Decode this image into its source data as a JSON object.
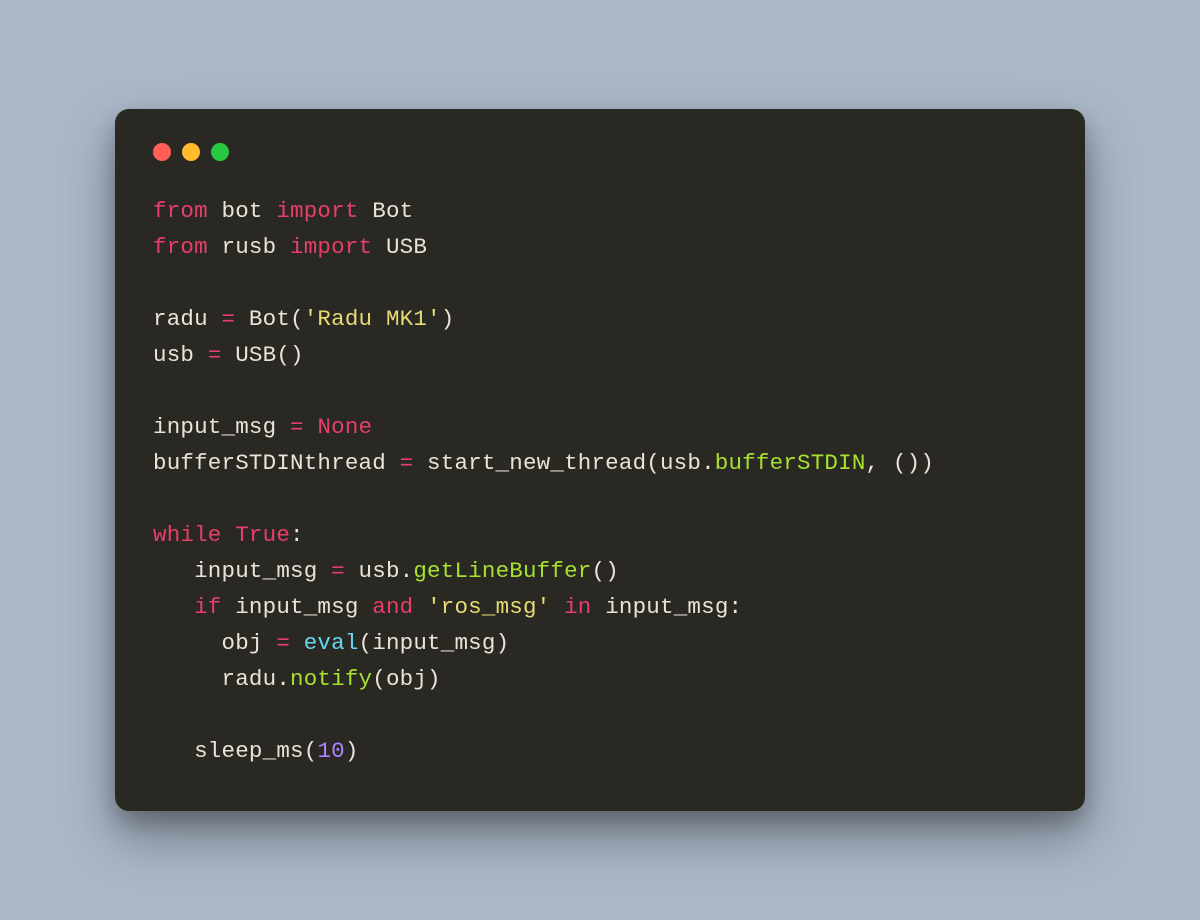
{
  "colors": {
    "background": "#aab7c7",
    "window": "#2a2823",
    "red": "#ff5f57",
    "yellow": "#febc2e",
    "green": "#28c840",
    "keyword": "#e83e6d",
    "string": "#e6db74",
    "function": "#a6e22e",
    "builtin": "#66d9ef",
    "number": "#ae81ff",
    "plain": "#e8e4d8"
  },
  "code": {
    "l1": {
      "a": "from",
      "b": " bot ",
      "c": "import",
      "d": " Bot"
    },
    "l2": {
      "a": "from",
      "b": " rusb ",
      "c": "import",
      "d": " USB"
    },
    "l3": "",
    "l4": {
      "a": "radu ",
      "b": "=",
      "c": " Bot(",
      "d": "'Radu MK1'",
      "e": ")"
    },
    "l5": {
      "a": "usb ",
      "b": "=",
      "c": " USB()"
    },
    "l6": "",
    "l7": {
      "a": "input_msg ",
      "b": "=",
      "c": " ",
      "d": "None"
    },
    "l8": {
      "a": "bufferSTDINthread ",
      "b": "=",
      "c": " start_new_thread(usb.",
      "d": "bufferSTDIN",
      "e": ", ())"
    },
    "l9": "",
    "l10": {
      "a": "while",
      "b": " ",
      "c": "True",
      "d": ":"
    },
    "l11": {
      "a": "   input_msg ",
      "b": "=",
      "c": " usb.",
      "d": "getLineBuffer",
      "e": "()"
    },
    "l12": {
      "a": "   ",
      "b": "if",
      "c": " input_msg ",
      "d": "and",
      "e": " ",
      "f": "'ros_msg'",
      "g": " ",
      "h": "in",
      "i": " input_msg:"
    },
    "l13": {
      "a": "     obj ",
      "b": "=",
      "c": " ",
      "d": "eval",
      "e": "(input_msg)"
    },
    "l14": {
      "a": "     radu.",
      "b": "notify",
      "c": "(obj)"
    },
    "l15": "",
    "l16": {
      "a": "   sleep_ms(",
      "b": "10",
      "c": ")"
    }
  }
}
